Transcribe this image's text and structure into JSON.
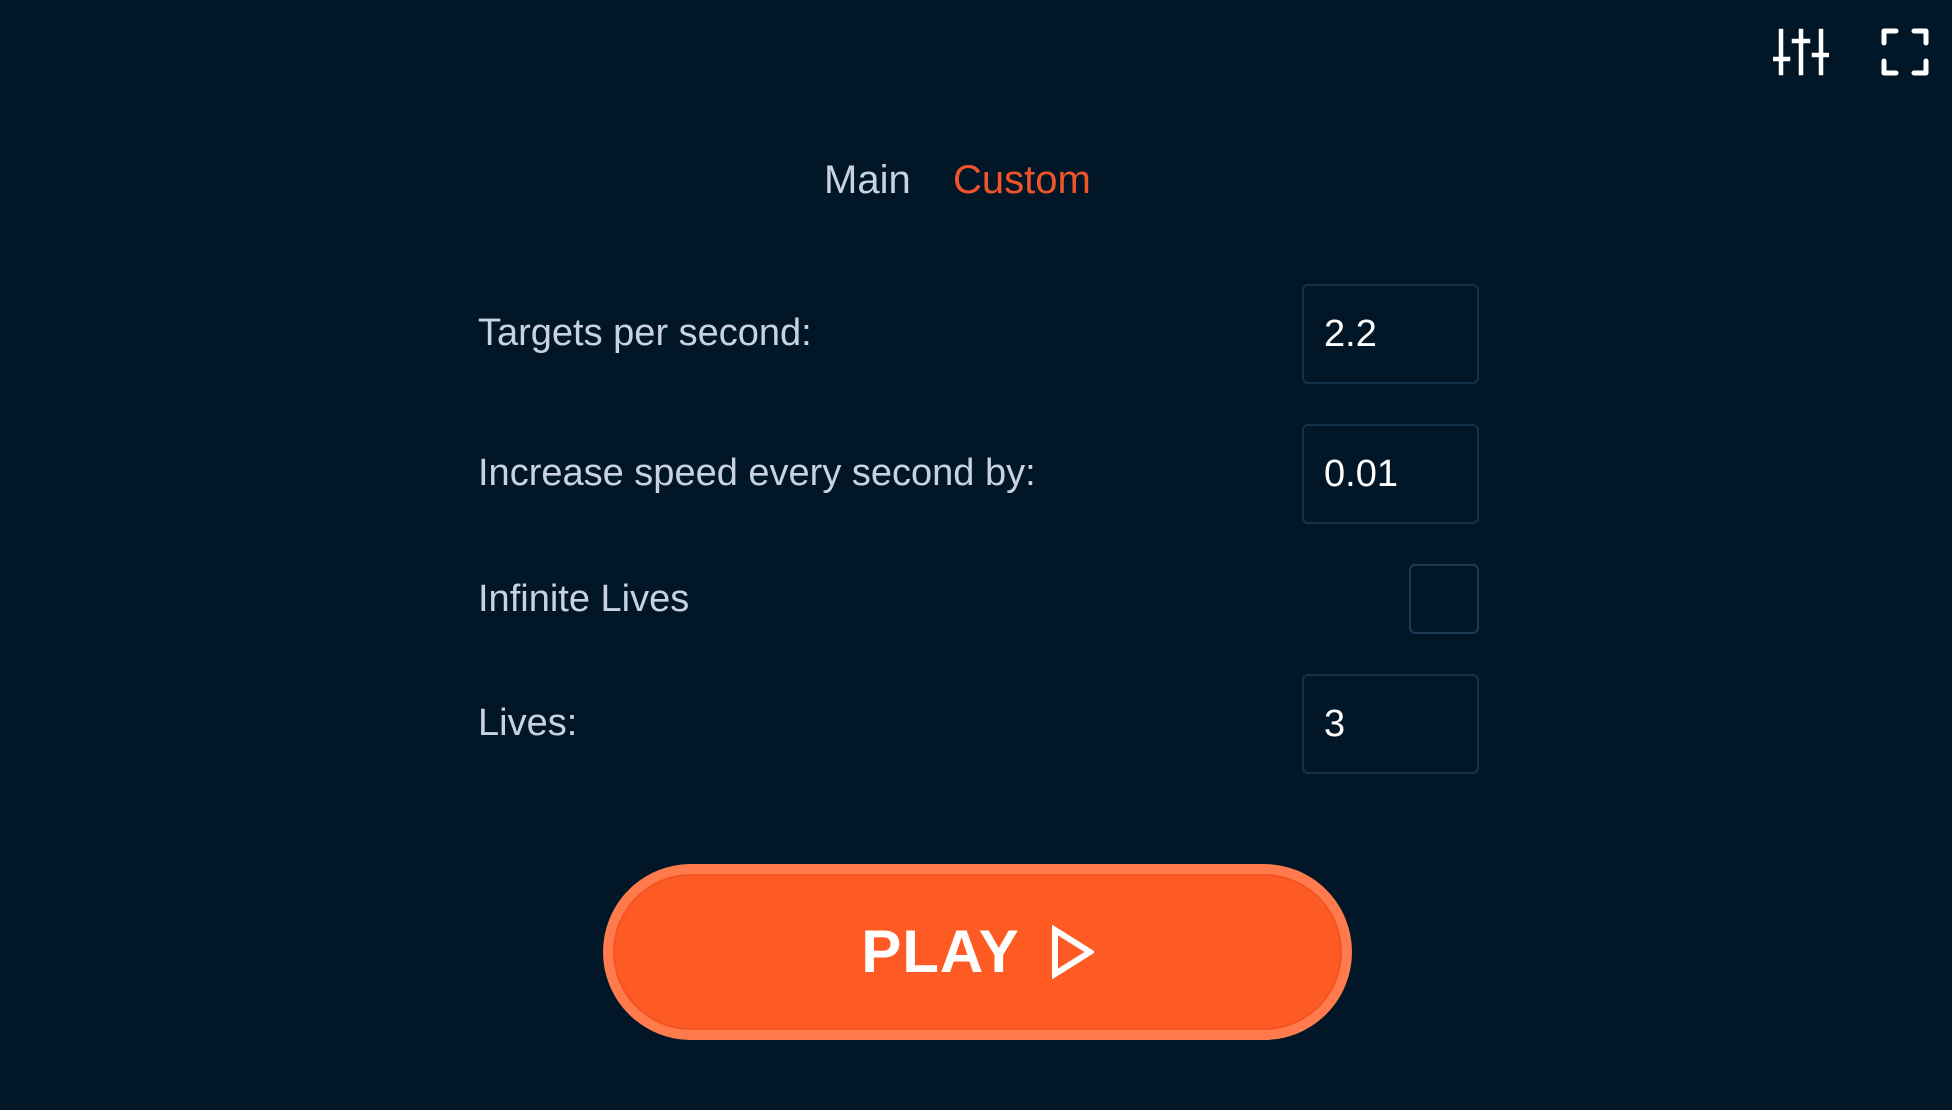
{
  "toolbar": {
    "settings_icon": "sliders-icon",
    "fullscreen_icon": "fullscreen-icon"
  },
  "tabs": [
    {
      "label": "Main",
      "active": false
    },
    {
      "label": "Custom",
      "active": true
    }
  ],
  "settings": {
    "targets_per_second": {
      "label": "Targets per second:",
      "value": "2.2"
    },
    "speed_increase": {
      "label": "Increase speed every second by:",
      "value": "0.01"
    },
    "infinite_lives": {
      "label": "Infinite Lives",
      "checked": false
    },
    "lives": {
      "label": "Lives:",
      "value": "3"
    }
  },
  "play_button": {
    "label": "PLAY",
    "icon": "play-triangle-icon"
  },
  "colors": {
    "background": "#011728",
    "accent": "#fe5a23",
    "active_tab": "#f2542a",
    "text": "#c9d3df"
  }
}
